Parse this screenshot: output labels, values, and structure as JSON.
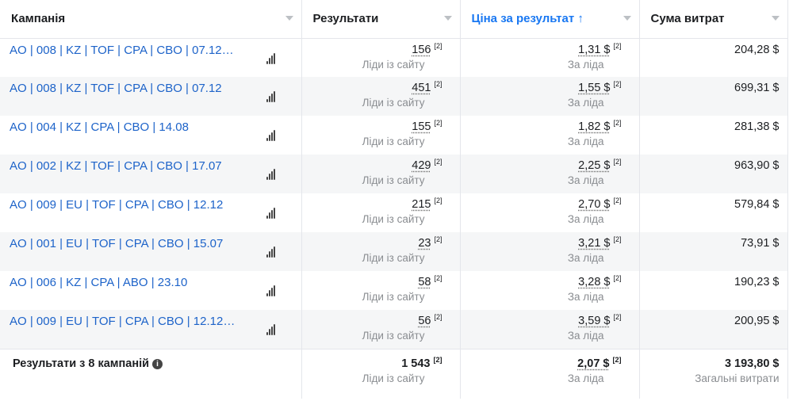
{
  "headers": {
    "campaign": "Кампанія",
    "results": "Результати",
    "cost": "Ціна за результат",
    "cost_sort": "↑",
    "spend": "Сума витрат"
  },
  "rows": [
    {
      "name": "AO | 008 | KZ | TOF | CPA | CBO | 07.12 — ...",
      "results": "156",
      "cost": "1,31 $",
      "spend": "204,28 $"
    },
    {
      "name": "AO | 008 | KZ | TOF | CPA | CBO | 07.12",
      "results": "451",
      "cost": "1,55 $",
      "spend": "699,31 $"
    },
    {
      "name": "AO | 004 | KZ | CPA | CBO | 14.08",
      "results": "155",
      "cost": "1,82 $",
      "spend": "281,38 $"
    },
    {
      "name": "AO | 002 | KZ | TOF | CPA | CBO | 17.07",
      "results": "429",
      "cost": "2,25 $",
      "spend": "963,90 $"
    },
    {
      "name": "AO | 009 | EU | TOF | CPA | CBO | 12.12",
      "results": "215",
      "cost": "2,70 $",
      "spend": "579,84 $"
    },
    {
      "name": "AO | 001 | EU | TOF | CPA | CBO | 15.07",
      "results": "23",
      "cost": "3,21 $",
      "spend": "73,91 $"
    },
    {
      "name": "AO | 006 | KZ | CPA | ABO | 23.10",
      "results": "58",
      "cost": "3,28 $",
      "spend": "190,23 $"
    },
    {
      "name": "AO | 009 | EU | TOF | CPA | CBO | 12.12 — ...",
      "results": "56",
      "cost": "3,59 $",
      "spend": "200,95 $"
    }
  ],
  "labels": {
    "footnote": "[2]",
    "results_sub": "Ліди із сайту",
    "cost_sub": "За ліда",
    "info": "i"
  },
  "footer": {
    "title": "Результати з 8 кампаній",
    "results": "1 543",
    "cost": "2,07 $",
    "spend": "3 193,80 $",
    "spend_sub": "Загальні витрати"
  }
}
